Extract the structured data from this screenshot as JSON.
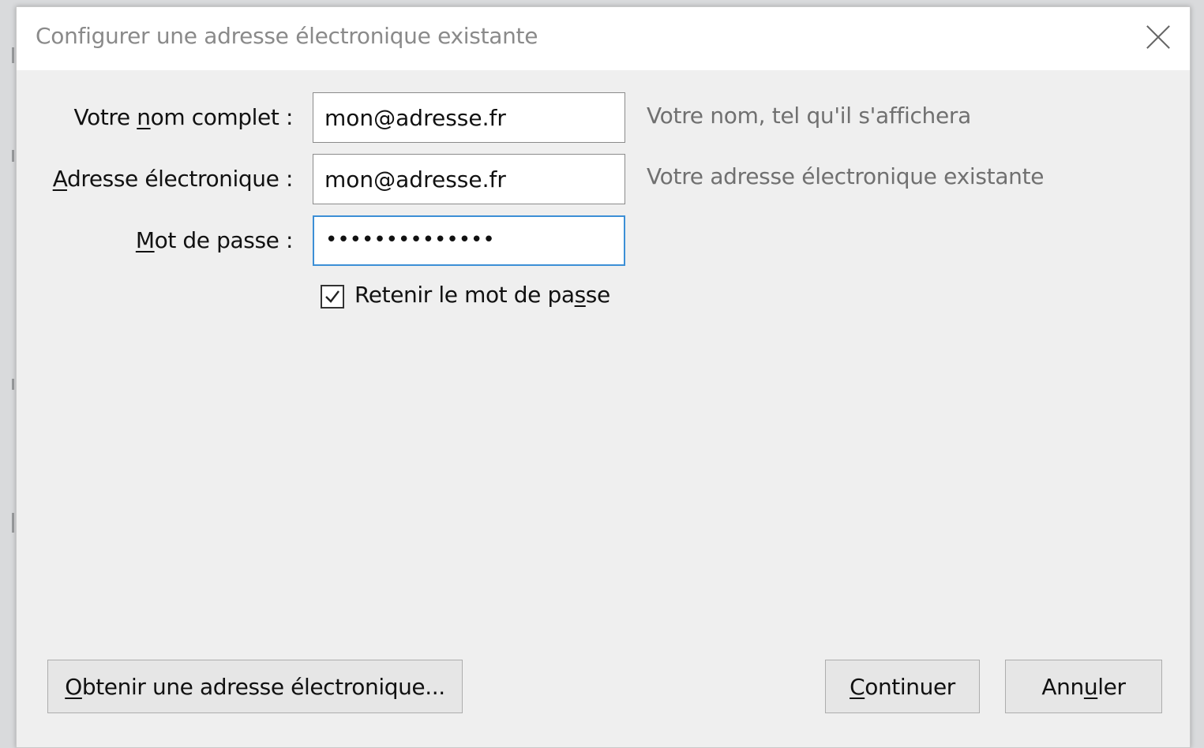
{
  "dialog": {
    "title": "Configurer une adresse électronique existante"
  },
  "form": {
    "name": {
      "label_pre": "Votre ",
      "label_key": "n",
      "label_post": "om complet :",
      "value": "mon@adresse.fr",
      "hint": "Votre nom, tel qu'il s'affichera"
    },
    "email": {
      "label_pre": "",
      "label_key": "A",
      "label_post": "dresse électronique :",
      "value": "mon@adresse.fr",
      "hint": "Votre adresse électronique existante"
    },
    "password": {
      "label_pre": "",
      "label_key": "M",
      "label_post": "ot de passe :",
      "value": "••••••••••••••"
    },
    "remember": {
      "label_pre": "Retenir le mot de pa",
      "label_key": "s",
      "label_post": "se",
      "checked": true
    }
  },
  "buttons": {
    "get_email": {
      "key": "O",
      "rest": "btenir une adresse électronique..."
    },
    "continue": {
      "key": "C",
      "rest": "ontinuer"
    },
    "cancel": {
      "pre": "Ann",
      "key": "u",
      "post": "ler"
    }
  },
  "colors": {
    "focus_border": "#3c8fd6",
    "dialog_bg": "#efefef"
  }
}
